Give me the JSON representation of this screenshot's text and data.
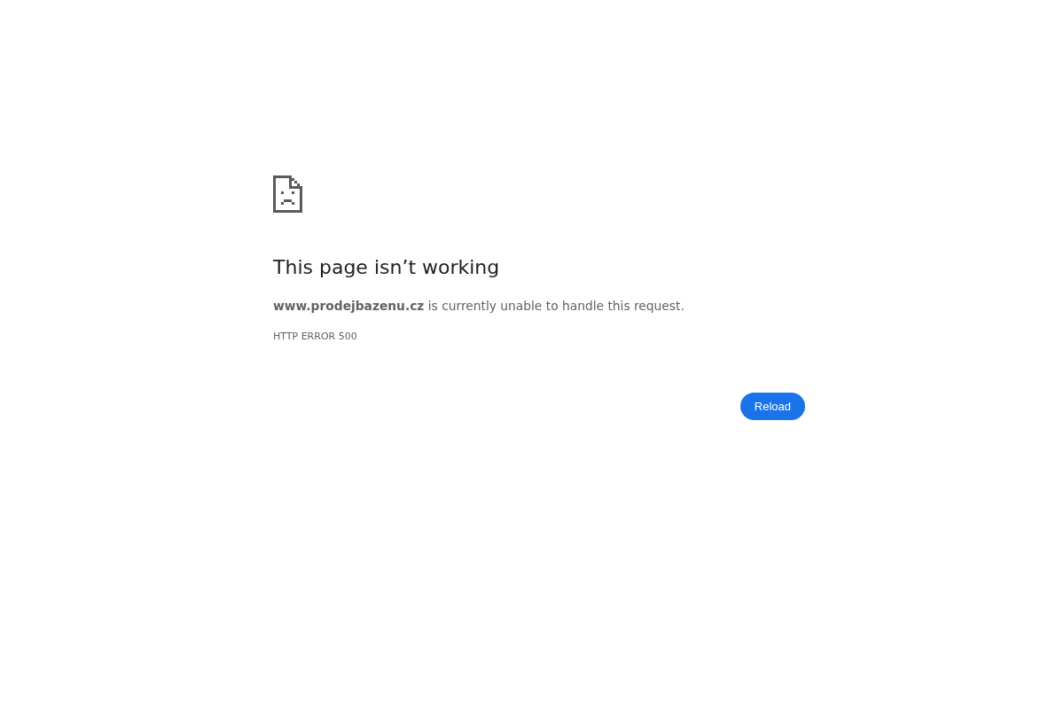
{
  "error_page": {
    "title": "This page isn’t working",
    "message": "**www.prodejbazenu.cz** is currently unable to handle this request.",
    "error_code": "HTTP ERROR 500",
    "buttons": [
      {
        "label": "Reload"
      }
    ]
  }
}
